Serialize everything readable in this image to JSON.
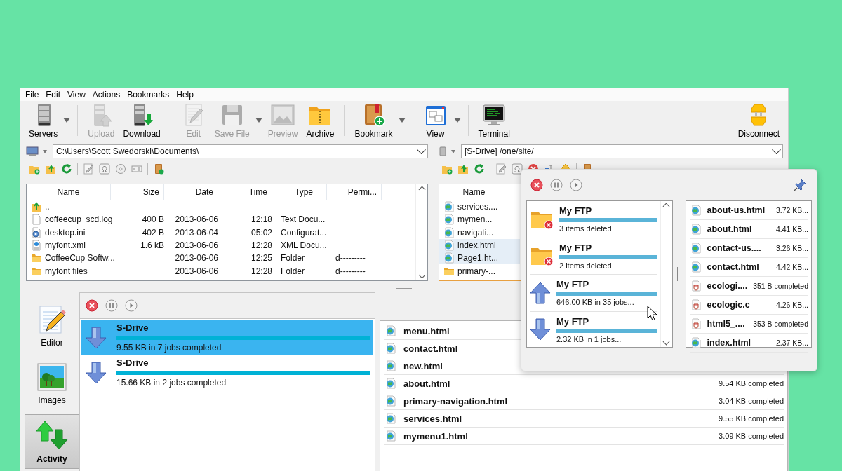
{
  "menu": [
    "File",
    "Edit",
    "View",
    "Actions",
    "Bookmarks",
    "Help"
  ],
  "toolbar": {
    "groups": [
      [
        {
          "kind": "servers",
          "label": "Servers",
          "dropdown": true,
          "disabled": false
        }
      ],
      [
        {
          "kind": "upload",
          "label": "Upload",
          "dropdown": false,
          "disabled": true
        },
        {
          "kind": "download",
          "label": "Download",
          "dropdown": false,
          "disabled": false
        }
      ],
      [
        {
          "kind": "edit",
          "label": "Edit",
          "dropdown": false,
          "disabled": true
        },
        {
          "kind": "save",
          "label": "Save File",
          "dropdown": true,
          "disabled": true
        },
        {
          "kind": "preview",
          "label": "Preview",
          "dropdown": false,
          "disabled": true
        },
        {
          "kind": "archive",
          "label": "Archive",
          "dropdown": false,
          "disabled": false
        }
      ],
      [
        {
          "kind": "bookmark",
          "label": "Bookmark",
          "dropdown": true,
          "disabled": false
        }
      ],
      [
        {
          "kind": "view",
          "label": "View",
          "dropdown": true,
          "disabled": false
        }
      ],
      [
        {
          "kind": "terminal",
          "label": "Terminal",
          "dropdown": false,
          "disabled": false
        }
      ]
    ],
    "right": {
      "kind": "disconnect",
      "label": "Disconnect"
    }
  },
  "local": {
    "path": "C:\\Users\\Scott Swedorski\\Documents\\",
    "columns": [
      "Name",
      "Size",
      "Date",
      "Time",
      "Type",
      "Permi..."
    ],
    "rows": [
      {
        "kind": "up",
        "name": ".."
      },
      {
        "kind": "text",
        "name": "coffeecup_scd.log",
        "size": "400 B",
        "date": "2013-06-06",
        "time": "12:18",
        "type": "Text Docu..."
      },
      {
        "kind": "config",
        "name": "desktop.ini",
        "size": "402 B",
        "date": "2013-06-04",
        "time": "05:02",
        "type": "Configurat..."
      },
      {
        "kind": "xml",
        "name": "myfont.xml",
        "size": "1.6 kB",
        "date": "2013-06-06",
        "time": "12:28",
        "type": "XML Docu..."
      },
      {
        "kind": "folder",
        "name": "CoffeeCup Softw...",
        "date": "2013-06-06",
        "time": "12:25",
        "type": "Folder",
        "perm": "d---------"
      },
      {
        "kind": "folder",
        "name": "myfont files",
        "date": "2013-06-06",
        "time": "12:28",
        "type": "Folder",
        "perm": "d---------"
      }
    ]
  },
  "remote": {
    "path": "[S-Drive] /one/site/",
    "columns": [
      "Name"
    ],
    "rows": [
      {
        "kind": "html",
        "name": "services....",
        "selected": false
      },
      {
        "kind": "html",
        "name": "mymen...",
        "selected": false
      },
      {
        "kind": "html",
        "name": "navigati...",
        "selected": false
      },
      {
        "kind": "html",
        "name": "index.html",
        "selected": true
      },
      {
        "kind": "html",
        "name": "Page1.ht...",
        "selected": true
      },
      {
        "kind": "folder",
        "name": "primary-...",
        "selected": false
      }
    ]
  },
  "sidebar": [
    {
      "kind": "editor",
      "label": "Editor",
      "selected": false
    },
    {
      "kind": "images",
      "label": "Images",
      "selected": false
    },
    {
      "kind": "activity",
      "label": "Activity",
      "selected": true
    }
  ],
  "queue": [
    {
      "title": "S-Drive",
      "detail": "9.55 KB in 7 jobs completed",
      "level": 1,
      "selected": true
    },
    {
      "title": "S-Drive",
      "detail": "15.66 KB in 2 jobs completed",
      "level": 1,
      "selected": false
    }
  ],
  "transfers": [
    {
      "name": "menu.html"
    },
    {
      "name": "contact.html"
    },
    {
      "name": "new.html"
    },
    {
      "name": "about.html",
      "status": "9.54 KB completed"
    },
    {
      "name": "primary-navigation.html",
      "status": "3.04 KB completed"
    },
    {
      "name": "services.html",
      "status": "9.55 KB completed"
    },
    {
      "name": "mymenu1.html",
      "status": "3.09 KB completed"
    }
  ],
  "popup": {
    "queue": [
      {
        "kind": "deleted",
        "title": "My FTP",
        "detail": "3 items deleted",
        "level": 1
      },
      {
        "kind": "deleted",
        "title": "My FTP",
        "detail": "2 items deleted",
        "level": 1
      },
      {
        "kind": "upload",
        "title": "My FTP",
        "detail": "646.00 KB in 35 jobs...",
        "level": 1
      },
      {
        "kind": "download",
        "title": "My FTP",
        "detail": "2.32 KB in 1 jobs...",
        "level": 1
      }
    ],
    "files": [
      {
        "kind": "html",
        "name": "about-us.html",
        "status": "3.72 KB..."
      },
      {
        "kind": "html",
        "name": "about.html",
        "status": "4.41 KB..."
      },
      {
        "kind": "html",
        "name": "contact-us....",
        "status": "3.26 KB..."
      },
      {
        "kind": "html",
        "name": "contact.html",
        "status": "4.42 KB..."
      },
      {
        "kind": "cup",
        "name": "ecologi....",
        "status": "351 B completed"
      },
      {
        "kind": "cup",
        "name": "ecologic.c",
        "status": "4.26 KB..."
      },
      {
        "kind": "cup",
        "name": "html5_....",
        "status": "353 B completed"
      },
      {
        "kind": "html",
        "name": "index.html",
        "status": "2.37 KB..."
      }
    ]
  }
}
